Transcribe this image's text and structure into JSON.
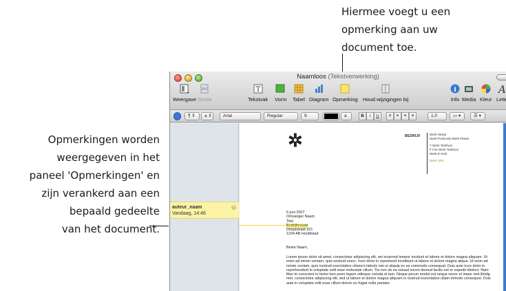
{
  "callouts": {
    "top": [
      "Hiermee voegt u een",
      "opmerking aan uw",
      "document toe."
    ],
    "left": [
      "Opmerkingen worden",
      "weergegeven in het",
      "paneel 'Opmerkingen' en",
      "zijn verankerd aan een",
      "bepaald gedeelte",
      "van het document."
    ]
  },
  "window": {
    "title": "Naamloos",
    "subtitle": "(Tekstverwerking)"
  },
  "toolbar": {
    "view": "Weergave",
    "sections": "Sectie",
    "textbox": "Tekstvak",
    "shape": "Vorm",
    "table": "Tabel",
    "chart": "Diagram",
    "comment": "Opmerking",
    "track_changes": "Houd wijzigingen bij",
    "info": "Info",
    "media": "Media",
    "colors": "Kleur",
    "fonts": "Lette"
  },
  "format_bar": {
    "paragraph_style": "¶",
    "char_style": "a",
    "font": "Arial",
    "typeface": "Regular",
    "size": "9",
    "text_color_hex": "#000000",
    "background": "a",
    "bold": "B",
    "italic": "I",
    "underline": "U",
    "line_spacing": "1.0"
  },
  "comment": {
    "author": "auteur_naam",
    "time": "Vandaag, 14:46"
  },
  "document": {
    "company": "BEDRIJF",
    "address": [
      "Werk Straat",
      "Werk Postcode Werk Plaats"
    ],
    "phones": [
      "T Werk Telefoon",
      "F Fax Werk Telefoon",
      "Werk E-mail"
    ],
    "url": "Werk URL",
    "date": "6 juni 2007",
    "recipient": [
      "Ontvanger Naam",
      "Titel",
      "Bedrijfsnaam",
      "Dorpsstraat 321",
      "1234 AB Hoofdstad"
    ],
    "salutation": "Beste Naam,",
    "body": "Lorem ipsum dolor sit amet, consectetur adipiscing elit, set eiusmod tempor incidunt et labore et dolore magna aliquam. Ut enim ad minim veniam, quis nostrud exerc. Irure dolor in reprehend incididunt ut labore et dolore magna aliqua. Ut enim ad minim veniam, quis nostrud exercitation ullamco laboris nisi ut aliquip ex ea commodo consequat. Duis aute irure dolor in reprehenderit in voluptate velit esse molestaie cillum. Tia non ob ea soluad incom dereud facilis est er expedit distinct. Nam liber te conscient to factor tum poen legum odioque civiuda et tam. Neque pecun modut est neque nonor et imper ned libidig met, consectetur adipiscing elit, sed ut labore et dolore magna aliquam is nostrud exercitation ullam mmodo consequet. Duis aute in voluptate velit esse cillum dolore eu fugiat nulla pariatur."
  },
  "colors": {
    "comment_yellow": "#fbf3a6",
    "url_olive": "#9b8d2e",
    "scroll_blue": "#3b7bd8"
  }
}
